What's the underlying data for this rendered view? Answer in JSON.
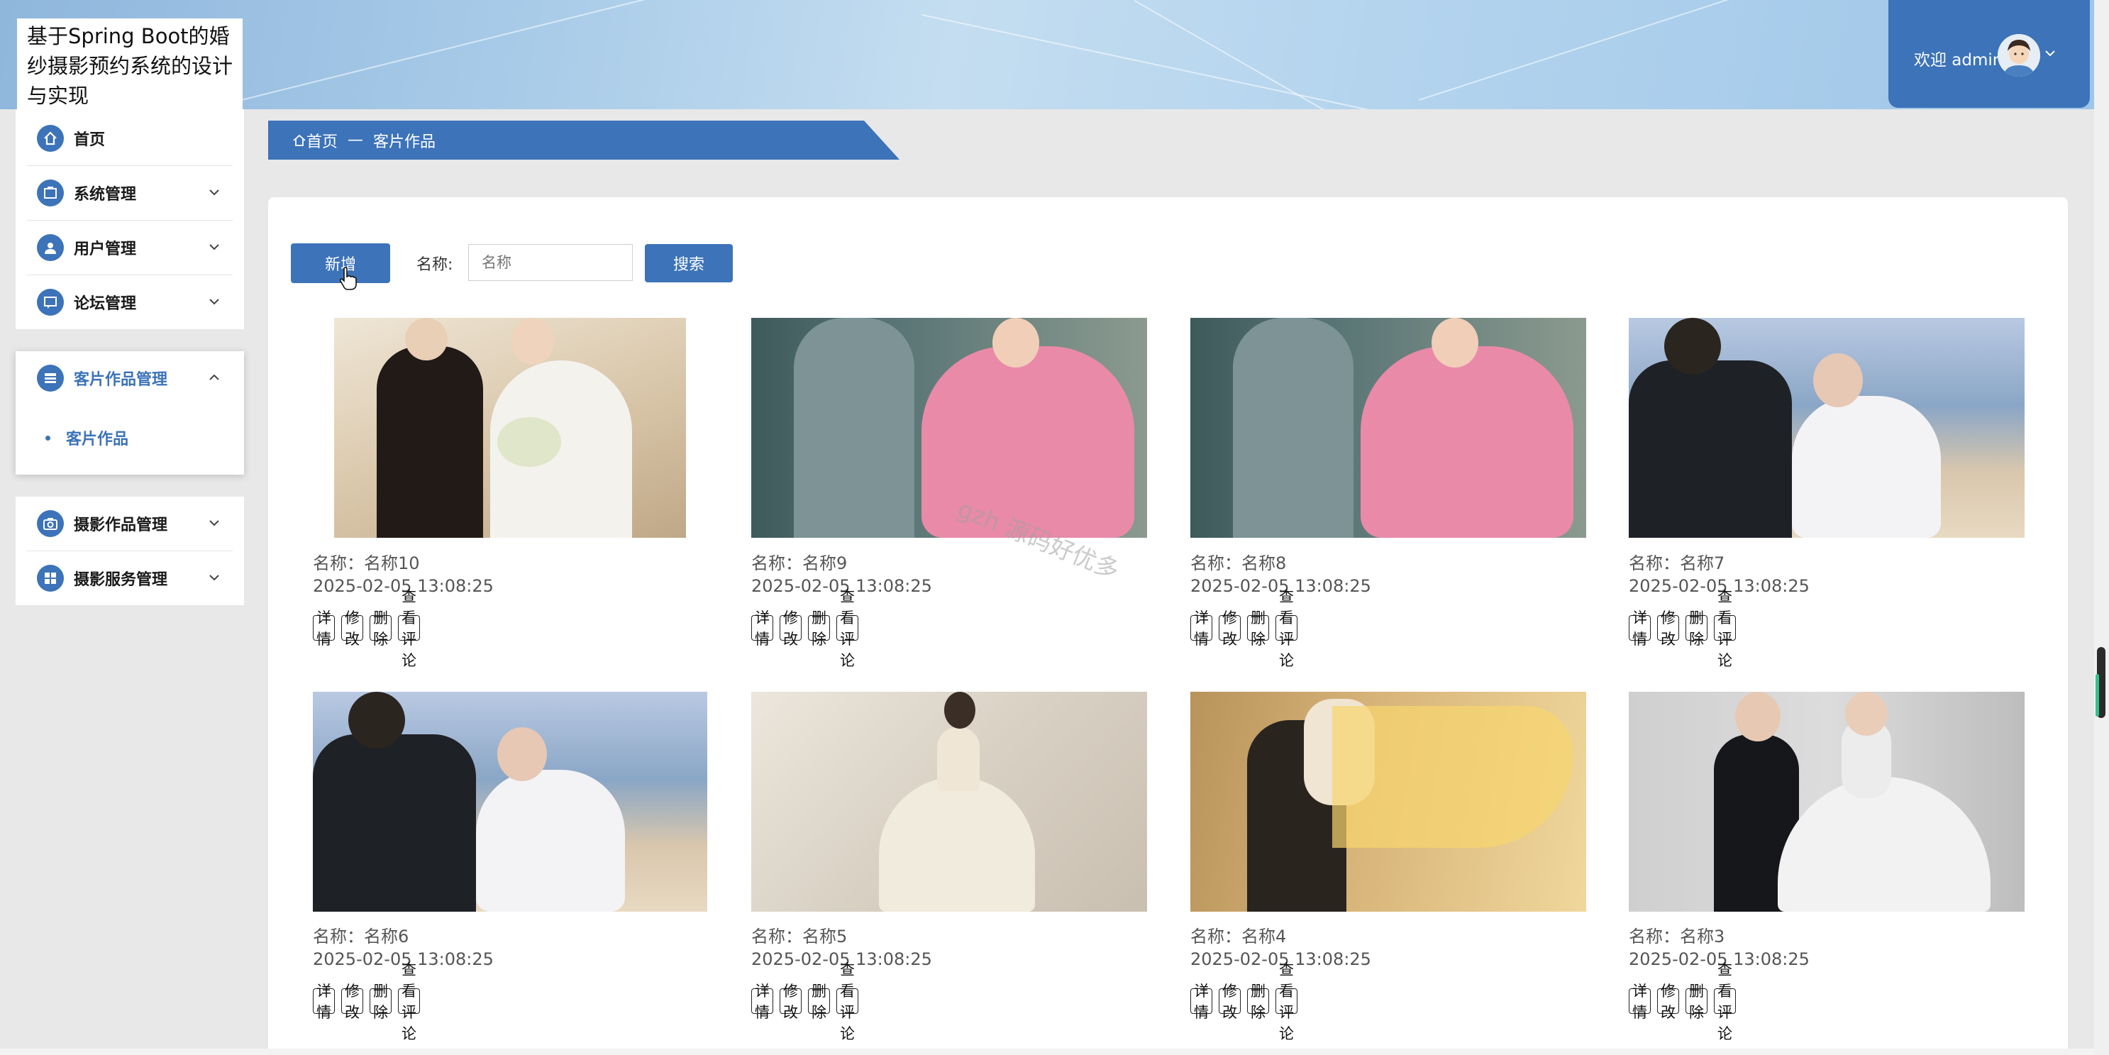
{
  "app": {
    "title": "基于Spring Boot的婚纱摄影预约系统的设计与实现"
  },
  "user": {
    "welcome": "欢迎 admin"
  },
  "sidebar": {
    "items": [
      {
        "label": "首页"
      },
      {
        "label": "系统管理"
      },
      {
        "label": "用户管理"
      },
      {
        "label": "论坛管理"
      }
    ],
    "active_group": {
      "label": "客片作品管理",
      "sub_items": [
        {
          "label": "客片作品"
        }
      ]
    },
    "more_items": [
      {
        "label": "摄影作品管理"
      },
      {
        "label": "摄影服务管理"
      }
    ]
  },
  "breadcrumb": {
    "home": "首页",
    "separator": "—",
    "current": "客片作品"
  },
  "toolbar": {
    "add_label": "新增",
    "search_label": "名称:",
    "search_placeholder": "名称",
    "search_button": "搜索"
  },
  "cards": [
    {
      "name": "名称：名称10",
      "date": "2025-02-05 13:08:25",
      "image": "wedding-couple-waving"
    },
    {
      "name": "名称：名称9",
      "date": "2025-02-05 13:08:25",
      "image": "couple-pink-gown-walking"
    },
    {
      "name": "名称：名称8",
      "date": "2025-02-05 13:08:25",
      "image": "couple-pink-gown-walking"
    },
    {
      "name": "名称：名称7",
      "date": "2025-02-05 13:08:25",
      "image": "couple-on-beach"
    },
    {
      "name": "名称：名称6",
      "date": "2025-02-05 13:08:25",
      "image": "couple-on-beach"
    },
    {
      "name": "名称：名称5",
      "date": "2025-02-05 13:08:25",
      "image": "bride-back-view"
    },
    {
      "name": "名称：名称4",
      "date": "2025-02-05 13:08:25",
      "image": "couple-yellow-veil"
    },
    {
      "name": "名称：名称3",
      "date": "2025-02-05 13:08:25",
      "image": "couple-studio-portrait"
    }
  ],
  "card_actions": {
    "detail": "详情",
    "edit": "修改",
    "delete": "删除",
    "comments": "查看评论"
  },
  "watermark": "gzh 源码好优多",
  "colors": {
    "primary": "#3c73b9",
    "page_bg": "#e8e8e8"
  }
}
